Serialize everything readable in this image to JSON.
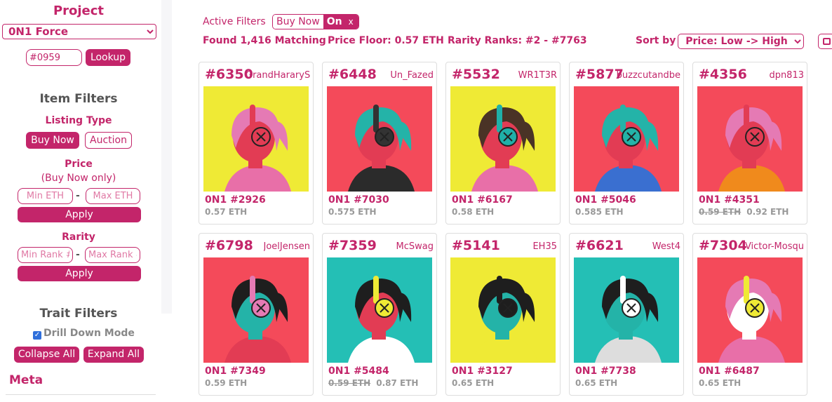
{
  "sidebar": {
    "project_heading": "Project",
    "project_select": "0N1 Force",
    "lookup_value": "#0959",
    "lookup_button": "Lookup",
    "item_filters": "Item Filters",
    "listing_type": "Listing Type",
    "buy_now": "Buy Now",
    "auction": "Auction",
    "price": "Price",
    "price_note": "(Buy Now only)",
    "min_eth": "Min ETH",
    "max_eth": "Max ETH",
    "dash": "-",
    "apply": "Apply",
    "rarity": "Rarity",
    "min_rank": "Min Rank #",
    "max_rank": "Max Rank #",
    "trait_filters": "Trait Filters",
    "drill_down": "Drill Down Mode",
    "collapse_all": "Collapse All",
    "expand_all": "Expand All",
    "meta": "Meta"
  },
  "topbar": {
    "active_filters": "Active Filters",
    "toggle_label": "Buy Now",
    "toggle_state": "On",
    "toggle_close": "x",
    "found": "Found 1,416 Matching",
    "floor": "Price Floor: 0.57 ETH",
    "rarity_ranks": "Rarity Ranks: #2 - #7763",
    "sort_by": "Sort by",
    "sort_value": "Price: Low -> High"
  },
  "cards": [
    {
      "num": "#6350",
      "owner": "GrandHararyS",
      "name": "0N1 #2926",
      "old": "",
      "price": "0.57 ETH",
      "bg": "#efea35",
      "skin": "#e23c54",
      "hair": "#e57ab4",
      "phone": "#e23c54",
      "jacket": "#e86fa8"
    },
    {
      "num": "#6448",
      "owner": "Un_Fazed",
      "name": "0N1 #7030",
      "old": "",
      "price": "0.575 ETH",
      "bg": "#f44a5a",
      "skin": "#e23c54",
      "hair": "#24b3a8",
      "phone": "#333333",
      "jacket": "#2b2b2b"
    },
    {
      "num": "#5532",
      "owner": "WR1T3R",
      "name": "0N1 #6167",
      "old": "",
      "price": "0.58 ETH",
      "bg": "#efea35",
      "skin": "#e23c54",
      "hair": "#4a3326",
      "phone": "#1fb0a8",
      "jacket": "#e86fa8"
    },
    {
      "num": "#5877",
      "owner": "buzzcutandbe",
      "name": "0N1 #5046",
      "old": "",
      "price": "0.585 ETH",
      "bg": "#f44a5a",
      "skin": "#e23c54",
      "hair": "#24b3a8",
      "phone": "#24b3a8",
      "jacket": "#3a6fd0"
    },
    {
      "num": "#4356",
      "owner": "dpn813",
      "name": "0N1 #4351",
      "old": "0.59 ETH",
      "price": "0.92 ETH",
      "bg": "#f44a5a",
      "skin": "#e23c54",
      "hair": "#e57ab4",
      "phone": "#e23c54",
      "jacket": "#f08a1c"
    },
    {
      "num": "#6798",
      "owner": "JoelJensen",
      "name": "0N1 #7349",
      "old": "",
      "price": "0.59 ETH",
      "bg": "#f44a5a",
      "skin": "#24b3a8",
      "hair": "#1e1e1e",
      "phone": "#e57ab4",
      "jacket": "#e23c54"
    },
    {
      "num": "#7359",
      "owner": "McSwag",
      "name": "0N1 #5484",
      "old": "0.59 ETH",
      "price": "0.87 ETH",
      "bg": "#24bfb5",
      "skin": "#e23c54",
      "hair": "#1e1e1e",
      "phone": "#efea35",
      "jacket": "#ffffff"
    },
    {
      "num": "#5141",
      "owner": "EH35",
      "name": "0N1 #3127",
      "old": "",
      "price": "0.65 ETH",
      "bg": "#efea35",
      "skin": "#24b3a8",
      "hair": "#1e1e1e",
      "phone": "#1e1e1e",
      "jacket": "#efea35"
    },
    {
      "num": "#6621",
      "owner": "West4",
      "name": "0N1 #7738",
      "old": "",
      "price": "0.65 ETH",
      "bg": "#24bfb5",
      "skin": "#24b3a8",
      "hair": "#1e1e1e",
      "phone": "#ffffff",
      "jacket": "#dddddd"
    },
    {
      "num": "#7304",
      "owner": "Victor-Mosqu",
      "name": "0N1 #6487",
      "old": "",
      "price": "0.65 ETH",
      "bg": "#f44a5a",
      "skin": "#ffffff",
      "hair": "#e57ab4",
      "phone": "#efea35",
      "jacket": "#e86fa8"
    }
  ]
}
